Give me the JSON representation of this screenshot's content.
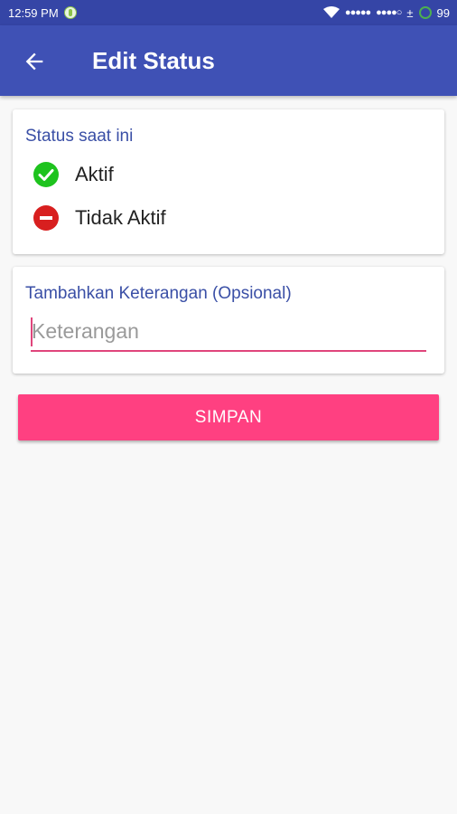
{
  "status_bar": {
    "time": "12:59 PM",
    "signal_1": "●●●●●",
    "signal_2": "●●●●○",
    "data_indicator": "±",
    "battery": "99"
  },
  "app_bar": {
    "title": "Edit Status",
    "back_icon": "arrow-back-icon"
  },
  "status_card": {
    "label": "Status saat ini",
    "options": [
      {
        "label": "Aktif",
        "icon": "check-circle-icon",
        "color": "#1ec31e"
      },
      {
        "label": "Tidak Aktif",
        "icon": "minus-circle-icon",
        "color": "#d81f1f"
      }
    ]
  },
  "note_card": {
    "label": "Tambahkan Keterangan (Opsional)",
    "input_value": "",
    "input_placeholder": "Keterangan"
  },
  "save_button": {
    "label": "SIMPAN"
  },
  "colors": {
    "primary": "#3f51b5",
    "primary_dark": "#3545a6",
    "accent": "#ff4081",
    "label_blue": "#3a4fa6"
  }
}
